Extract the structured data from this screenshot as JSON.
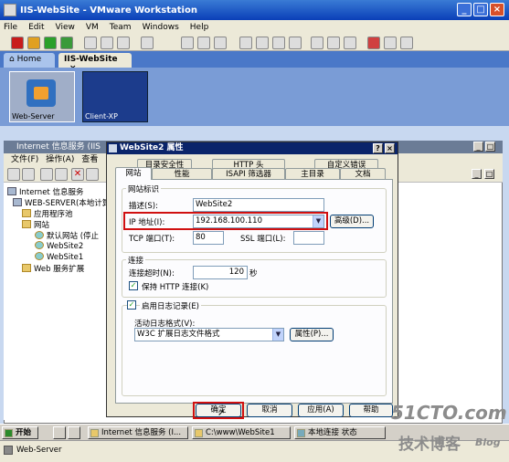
{
  "vmware": {
    "title": "IIS-WebSite - VMware Workstation",
    "menu": [
      "File",
      "Edit",
      "View",
      "VM",
      "Team",
      "Windows",
      "Help"
    ],
    "tabs": [
      {
        "label": "Home"
      },
      {
        "label": "IIS-WebSite"
      }
    ],
    "thumbnails": [
      {
        "label": "Web-Server"
      },
      {
        "label": "Client-XP"
      }
    ],
    "status_label": "Web-Server"
  },
  "mmc": {
    "title": "Internet 信息服务 (IIS",
    "menu": [
      "文件(F)",
      "操作(A)",
      "查看"
    ],
    "tree": [
      {
        "label": "Internet 信息服务"
      },
      {
        "label": "WEB-SERVER(本地计算机"
      },
      {
        "label": "应用程序池"
      },
      {
        "label": "网站"
      },
      {
        "label": "默认网站 (停止"
      },
      {
        "label": "WebSite2"
      },
      {
        "label": "WebSite1"
      },
      {
        "label": "Web 服务扩展"
      }
    ]
  },
  "dialog": {
    "title": "WebSite2 属性",
    "help_btn": "?",
    "close_btn": "×",
    "tabs_row1": [
      "目录安全性",
      "HTTP 头",
      "自定义错误"
    ],
    "tabs_row2": [
      "网站",
      "性能",
      "ISAPI 筛选器",
      "主目录",
      "文档"
    ],
    "site_id_group": "网站标识",
    "desc_label": "描述(S):",
    "desc_value": "WebSite2",
    "ip_label": "IP 地址(I):",
    "ip_value": "192.168.100.110",
    "advanced_btn": "高级(D)...",
    "tcp_label": "TCP 端口(T):",
    "tcp_value": "80",
    "ssl_label": "SSL 端口(L):",
    "ssl_value": "",
    "conn_group": "连接",
    "timeout_label": "连接超时(N):",
    "timeout_value": "120",
    "timeout_unit": "秒",
    "keepalive_label": "保持 HTTP 连接(K)",
    "logging_label": "启用日志记录(E)",
    "log_format_label": "活动日志格式(V):",
    "log_format_value": "W3C 扩展日志文件格式",
    "properties_btn": "属性(P)...",
    "ok_btn": "确定",
    "cancel_btn": "取消",
    "apply_btn": "应用(A)",
    "help_btn2": "帮助"
  },
  "taskbar": {
    "start": "开始",
    "tasks": [
      "Internet 信息服务 (I...",
      "C:\\www\\WebSite1",
      "本地连接 状态"
    ]
  },
  "watermark": {
    "line1": "51CTO.com",
    "line2": "技术博客",
    "line3": "Blog"
  },
  "colors": {
    "highlight_red": "#d01010",
    "title_blue": "#0a246a"
  }
}
